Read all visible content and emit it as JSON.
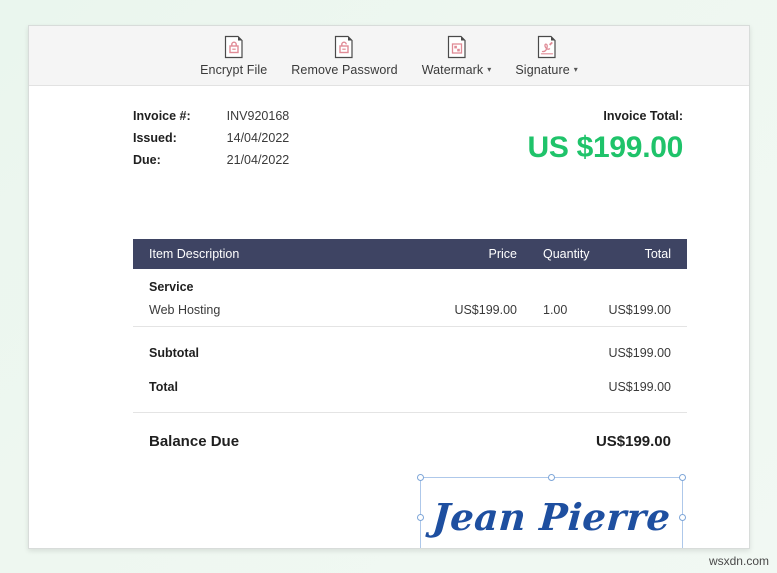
{
  "toolbar": {
    "items": [
      {
        "label": "Encrypt File",
        "icon": "lock-document-icon",
        "has_caret": false
      },
      {
        "label": "Remove Password",
        "icon": "unlock-document-icon",
        "has_caret": false
      },
      {
        "label": "Watermark",
        "icon": "watermark-document-icon",
        "has_caret": true
      },
      {
        "label": "Signature",
        "icon": "signature-pen-icon",
        "has_caret": true
      }
    ],
    "caret_glyph": "▾"
  },
  "invoice": {
    "meta": [
      {
        "key": "Invoice #:",
        "value": "INV920168"
      },
      {
        "key": "Issued:",
        "value": "14/04/2022"
      },
      {
        "key": "Due:",
        "value": "21/04/2022"
      }
    ],
    "total_label": "Invoice Total:",
    "total_amount": "US $199.00",
    "total_color": "#1fc36a",
    "table": {
      "headers": {
        "description": "Item Description",
        "price": "Price",
        "quantity": "Quantity",
        "total": "Total"
      },
      "header_bg": "#3e4463",
      "group": "Service",
      "rows": [
        {
          "description": "Web Hosting",
          "price": "US$199.00",
          "quantity": "1.00",
          "total": "US$199.00"
        }
      ],
      "summary": [
        {
          "label": "Subtotal",
          "value": "US$199.00"
        },
        {
          "label": "Total",
          "value": "US$199.00"
        }
      ],
      "balance": {
        "label": "Balance Due",
        "value": "US$199.00"
      }
    }
  },
  "signature": {
    "text": "Jean Pierre",
    "color": "#1e4fa0",
    "selection_border": "#aec8ea"
  },
  "footer": {
    "watermark": "wsxdn.com"
  }
}
